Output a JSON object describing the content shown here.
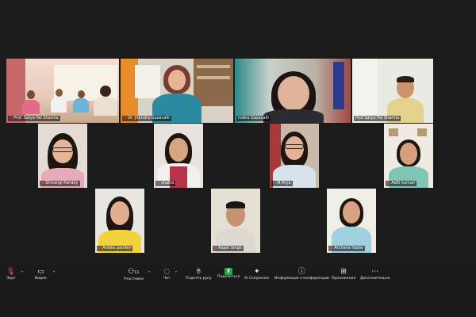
{
  "participants": [
    {
      "name": "Prof. Satya Pal Sharma",
      "muted": true
    },
    {
      "name": "Dr. Jitendra Gazavalli",
      "muted": true
    },
    {
      "name": "Indira Gazavalli",
      "muted": false,
      "active": true
    },
    {
      "name": "Prof Satya Pal Sharma",
      "muted": false
    },
    {
      "name": "Shivangi Pandey",
      "muted": true
    },
    {
      "name": "shalini",
      "muted": true
    },
    {
      "name": "M Arya",
      "muted": true
    },
    {
      "name": "Aditi kumari",
      "muted": true
    },
    {
      "name": "Ankita pandey",
      "muted": true
    },
    {
      "name": "Rajan Singh",
      "muted": true
    },
    {
      "name": "Archana Yadav",
      "muted": true
    }
  ],
  "toolbar": {
    "audio": "Звук",
    "video": "Видео",
    "participants": "Участники",
    "participants_count": "11",
    "chat": "Чат",
    "raise_hand": "Поднять руку",
    "share": "Поделиться",
    "ai_companion": "AI Companion",
    "info": "Информация о конференции",
    "apps": "Приложения",
    "more": "Дополнительно"
  },
  "colors": {
    "active_border": "#27c24c",
    "muted": "#ff4d4f",
    "share": "#27a84a"
  }
}
